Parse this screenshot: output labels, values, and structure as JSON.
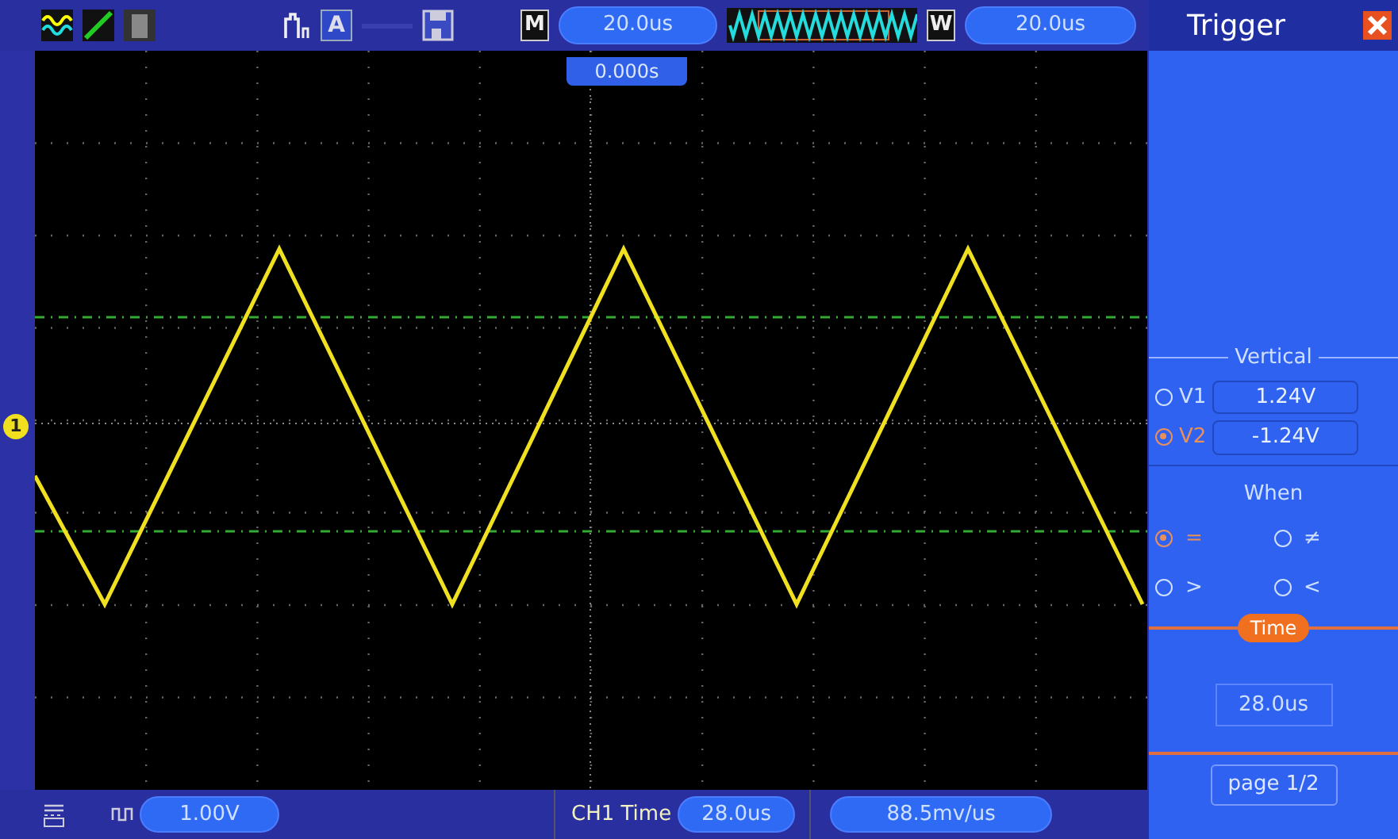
{
  "toolbar": {
    "a_label": "A",
    "m_label": "M",
    "timebase": "20.0us",
    "w_label": "W",
    "window_timebase": "20.0us"
  },
  "screen": {
    "trigger_position": "0.000s",
    "channel_marker": "1"
  },
  "panel": {
    "title": "Trigger",
    "vertical_heading": "Vertical",
    "cursors": [
      {
        "label": "V1",
        "value": "1.24V",
        "selected": false
      },
      {
        "label": "V2",
        "value": "-1.24V",
        "selected": true
      }
    ],
    "when_heading": "When",
    "conditions": [
      {
        "label": "=",
        "selected": true
      },
      {
        "label": "≠",
        "selected": false
      },
      {
        "label": ">",
        "selected": false
      },
      {
        "label": "<",
        "selected": false
      }
    ],
    "time_heading": "Time",
    "time_value": "28.0us",
    "page_button": "page 1/2"
  },
  "status_bar": {
    "channel_scale": "1.00V",
    "measure_label": "CH1 Time",
    "measure_value": "28.0us",
    "slope_value": "88.5mv/us"
  }
}
